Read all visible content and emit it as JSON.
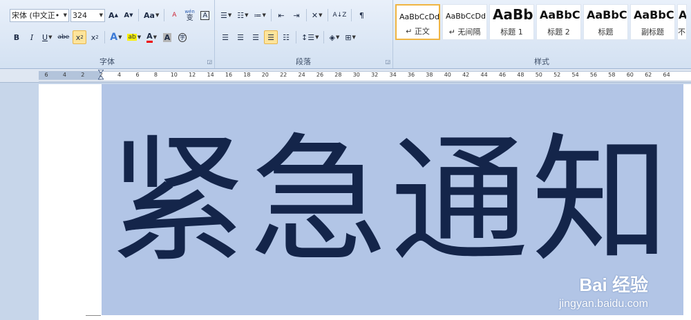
{
  "font_group": {
    "label": "字体",
    "font_name": "宋体 (中文正•",
    "font_size": "324",
    "grow_font": "A",
    "shrink_font": "A",
    "change_case": "Aa",
    "clear_format": "A",
    "pinyin_guide": "wén",
    "pinyin_char": "变",
    "char_border": "A",
    "bold": "B",
    "italic": "I",
    "underline": "U",
    "strikethrough": "abe",
    "subscript": "x",
    "superscript": "x",
    "text_effects": "A",
    "highlight": "ab",
    "font_color": "A",
    "char_shading": "A",
    "enclose_char": "字"
  },
  "paragraph_group": {
    "label": "段落"
  },
  "styles_group": {
    "label": "样式",
    "tiles": [
      {
        "sample": "AaBbCcDd",
        "label": "↵ 正文"
      },
      {
        "sample": "AaBbCcDd",
        "label": "↵ 无间隔"
      },
      {
        "sample": "AaBb",
        "label": "标题 1"
      },
      {
        "sample": "AaBbC",
        "label": "标题 2"
      },
      {
        "sample": "AaBbC",
        "label": "标题"
      },
      {
        "sample": "AaBbC",
        "label": "副标题"
      },
      {
        "sample": "A",
        "label": "不"
      }
    ]
  },
  "ruler": {
    "ticks": [
      "6",
      "4",
      "2",
      "2",
      "4",
      "6",
      "8",
      "10",
      "12",
      "14",
      "16",
      "18",
      "20",
      "22",
      "24",
      "26",
      "28",
      "30",
      "32",
      "34",
      "36",
      "38",
      "40",
      "42",
      "44",
      "46",
      "48",
      "50",
      "52",
      "54",
      "56",
      "58",
      "60",
      "62",
      "64"
    ]
  },
  "document": {
    "text": "紧急通知"
  },
  "watermark": {
    "logo": "Bai 经验",
    "url": "jingyan.baidu.com"
  },
  "colors": {
    "selection": "#b2c5e6",
    "text": "#14254a",
    "ribbon": "#e1eaf6"
  }
}
